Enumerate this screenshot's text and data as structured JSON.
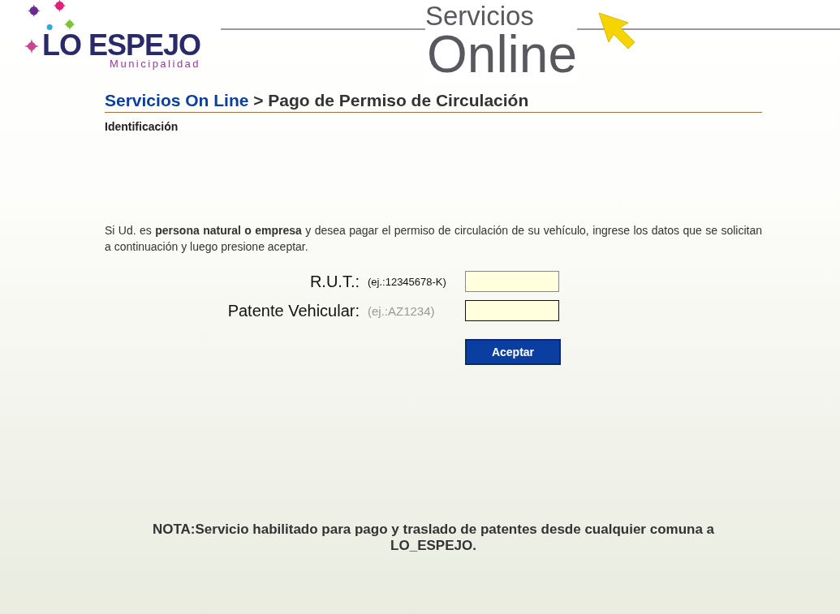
{
  "logo": {
    "name": "LO ESPEJO",
    "subtitle": "Municipalidad"
  },
  "banner": {
    "top": "Servicios",
    "bottom": "Online"
  },
  "breadcrumb": {
    "link": "Servicios On Line",
    "current": "> Pago de Permiso de Circulación"
  },
  "section": "Identificación",
  "intro": "Si Ud. es **persona natural o empresa** y desea pagar el permiso de circulación de su vehículo, ingrese los datos que se solicitan a continuación y luego presione aceptar.",
  "fields": [
    {
      "label": "R.U.T.:",
      "hint": "(ej.:12345678-K)",
      "hint_dimmed": false,
      "focused": false
    },
    {
      "label": "Patente Vehicular:",
      "hint": "(ej.:AZ1234)",
      "hint_dimmed": true,
      "focused": true
    }
  ],
  "submit": "Aceptar",
  "note": "NOTA:Servicio habilitado para pago y traslado de patentes desde cualquier comuna a LO_ESPEJO."
}
